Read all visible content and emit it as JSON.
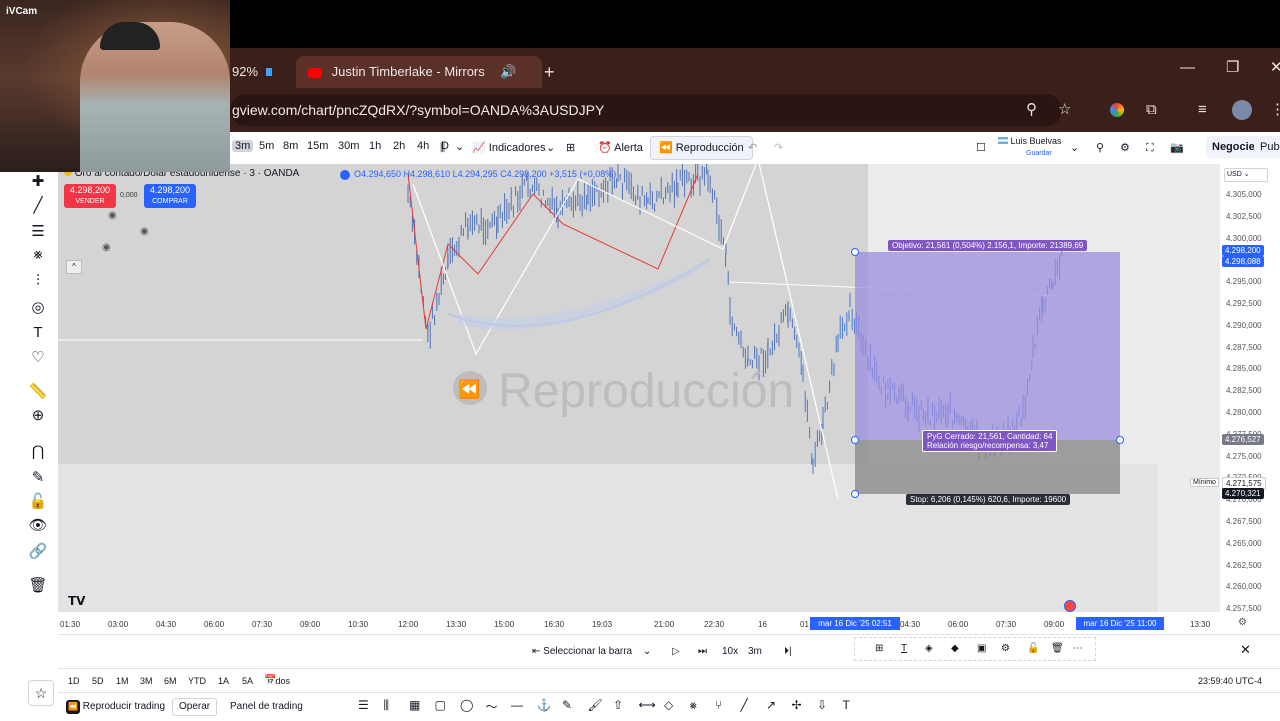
{
  "webcam": {
    "label": "iVCam"
  },
  "browser": {
    "tabs": [
      {
        "label": "92%",
        "close": "✕"
      },
      {
        "label": "Justin Timberlake - Mirrors",
        "close": "✕"
      }
    ],
    "new_tab": "+",
    "url": "gview.com/chart/pncZQdRX/?symbol=OANDA%3AUSDJPY"
  },
  "toolbar": {
    "intervals": [
      "3m",
      "5m",
      "8m",
      "15m",
      "30m",
      "1h",
      "2h",
      "4h",
      "D"
    ],
    "indicators": "Indicadores",
    "alert": "Alerta",
    "replay": "Reproducción",
    "user_name": "Luis Buelvas",
    "user_sub": "Guardar",
    "trade": "Negocie",
    "publish": "Publi"
  },
  "symbol": {
    "title": "Oro al contado/Dólar estadounidense · 3 · OANDA",
    "ohlc": "O4.294,650  H4.298,610  L4.294,295  C4.298,200  +3,515 (+0,08%)",
    "sell_price": "4.298,200",
    "sell_label": "VENDER",
    "spread": "0,000",
    "buy_price": "4.298,200",
    "buy_label": "COMPRAR"
  },
  "chart": {
    "watermark": "Reproducción",
    "position": {
      "target": "Objetivo: 21,561 (0,504%) 2.156,1, Importe: 21389,69",
      "pnl_line1": "PyG Cerrado: 21,561, Cantidad: 64",
      "pnl_line2": "Relación riesgo/recompensa: 3,47",
      "stop": "Stop: 6,206 (0,145%) 620,6, Importe: 19600"
    },
    "minimo": "Mínimo"
  },
  "price_axis": {
    "currency": "USD",
    "labels": [
      "4.305,000",
      "4.302,500",
      "4.300,000",
      "4.297,500",
      "4.295,000",
      "4.292,500",
      "4.290,000",
      "4.287,500",
      "4.285,000",
      "4.282,500",
      "4.280,000",
      "4.277,500",
      "4.275,000",
      "4.272,500",
      "4.270,000",
      "4.267,500",
      "4.265,000",
      "4.262,500",
      "4.260,000",
      "4.257,500"
    ],
    "badge_blue1": "4.298,200",
    "badge_blue2": "4.298,088",
    "badge_gray": "4.276,527",
    "badge_min": "4.271,575",
    "badge_dark": "4.270,321"
  },
  "time_axis": {
    "labels": [
      "01:30",
      "03:00",
      "04:30",
      "06:00",
      "07:30",
      "09:00",
      "10:30",
      "12:00",
      "13:30",
      "15:00",
      "16:30",
      "19:03",
      "21:00",
      "22:30",
      "16",
      "01",
      "04:30",
      "06:00",
      "07:30",
      "09:00",
      "13:30"
    ],
    "highlight_start": "mar 16 Dic '25   02:51",
    "highlight_end": "mar 16 Dic '25   11:00"
  },
  "replay": {
    "select_bar": "Seleccionar la barra",
    "speed": "10x",
    "interval": "3m"
  },
  "ranges": {
    "items": [
      "1D",
      "5D",
      "1M",
      "3M",
      "6M",
      "YTD",
      "1A",
      "5A",
      "Todos"
    ],
    "clock": "23:59:40 UTC-4"
  },
  "bottom": {
    "replay_trading": "Reproducir trading",
    "operate": "Operar",
    "panel": "Panel de trading"
  },
  "colors": {
    "target_fill": "#9b8ee0",
    "stop_fill": "#8a8a8a",
    "replay_bg": "#dcdcdc",
    "accent_blue": "#2962ff",
    "sell_red": "#f23645"
  }
}
